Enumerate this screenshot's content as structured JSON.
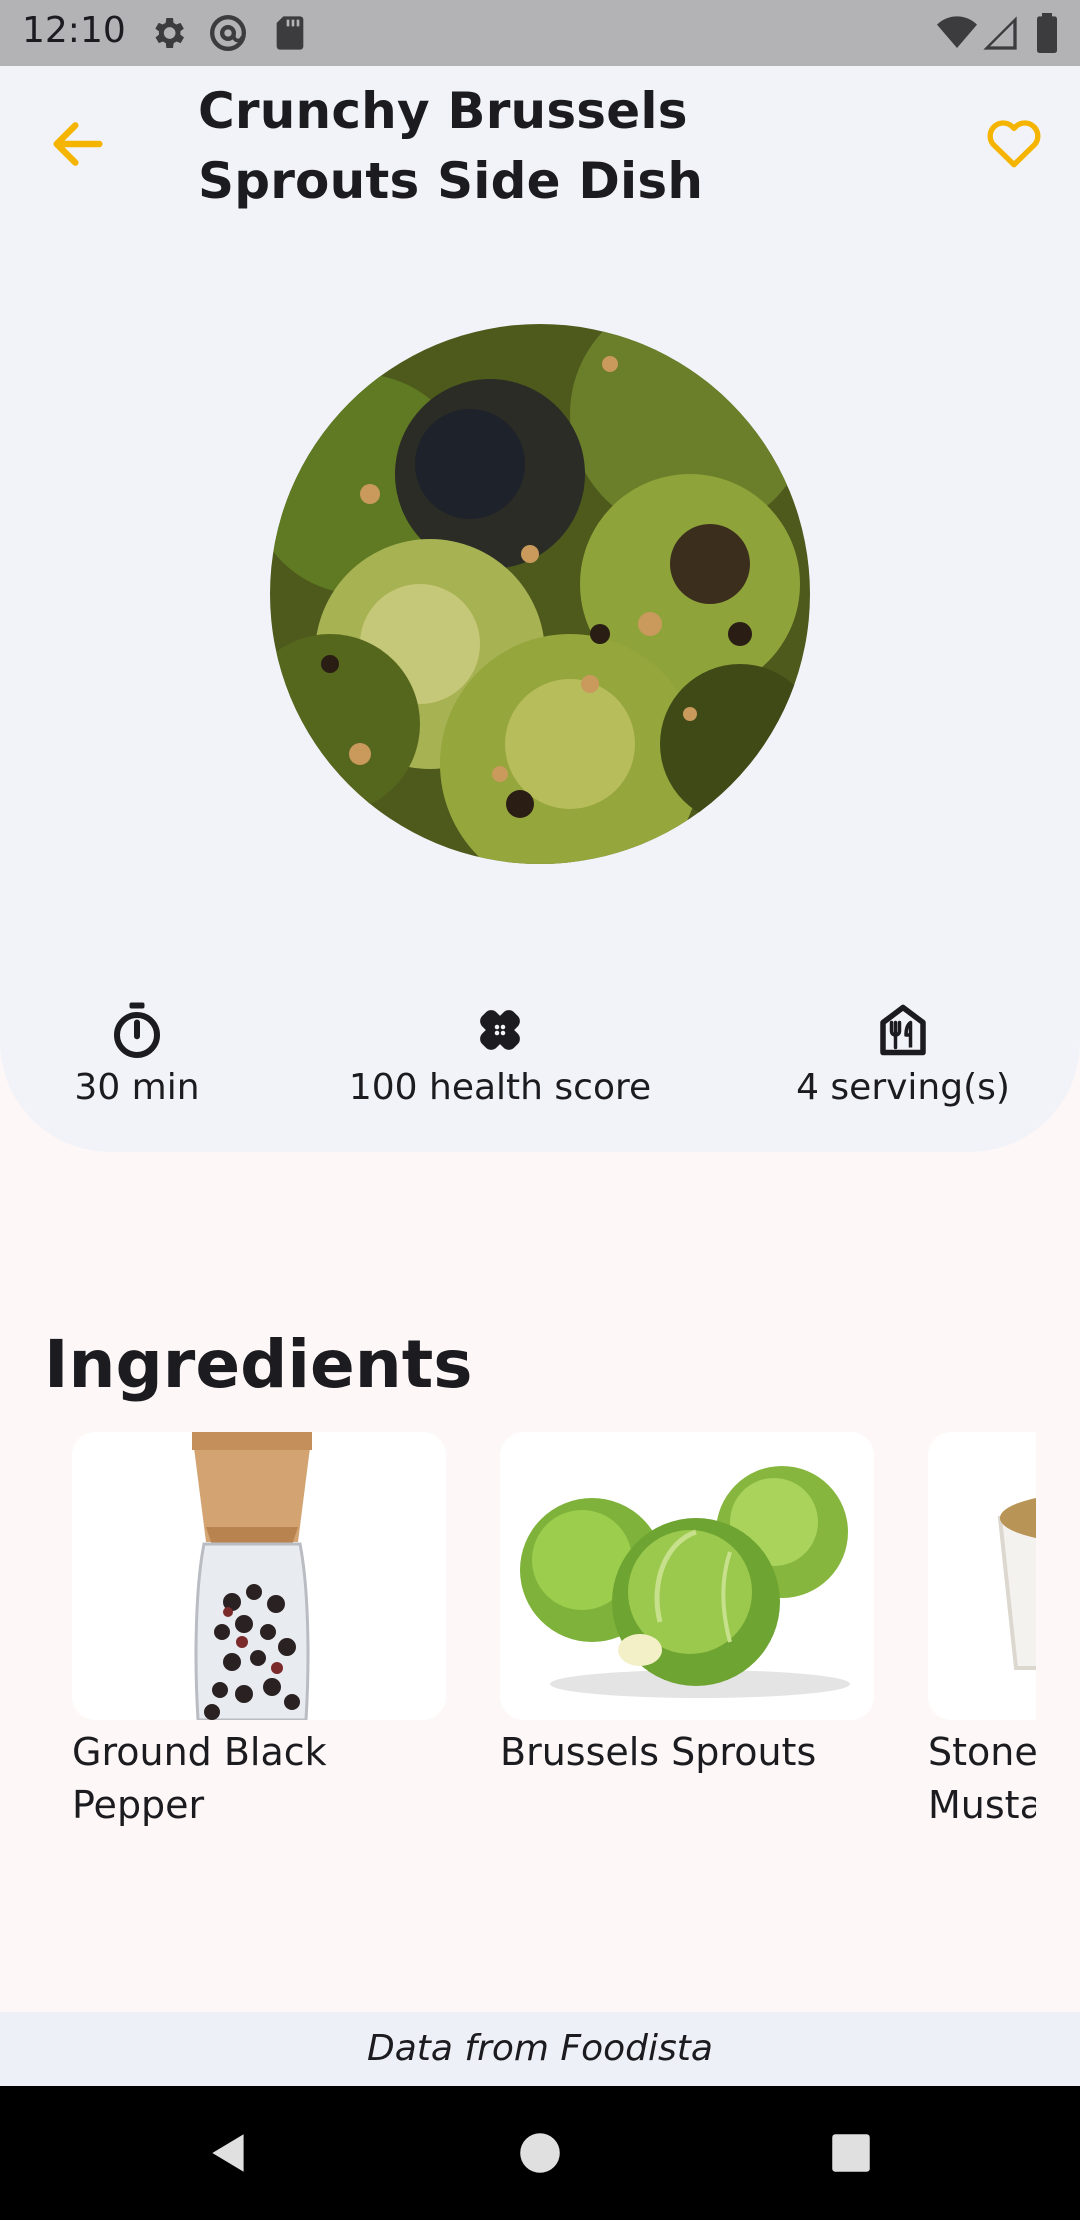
{
  "status_bar": {
    "time": "12:10",
    "left_icons": [
      "gear-icon",
      "at-sign-icon",
      "sd-card-icon"
    ],
    "right_icons": [
      "wifi-icon",
      "cell-signal-icon",
      "battery-icon"
    ]
  },
  "header": {
    "title": "Crunchy Brussels Sprouts Side Dish",
    "back_icon": "arrow-back-icon",
    "favorite_icon": "heart-outline-icon",
    "accent_color": "#f4b400"
  },
  "stats": [
    {
      "icon": "timer-icon",
      "label": "30 min"
    },
    {
      "icon": "bandage-icon",
      "label": "100 health score"
    },
    {
      "icon": "restaurant-icon",
      "label": "4 serving(s)"
    }
  ],
  "ingredients": {
    "title": "Ingredients",
    "items": [
      {
        "name": "Ground Black Pepper"
      },
      {
        "name": "Brussels Sprouts"
      },
      {
        "name": "Stone Ground Mustard"
      }
    ]
  },
  "footer": {
    "text": "Data from Foodista"
  },
  "nav_bar": {
    "buttons": [
      "back-triangle-icon",
      "home-circle-icon",
      "recents-square-icon"
    ]
  }
}
